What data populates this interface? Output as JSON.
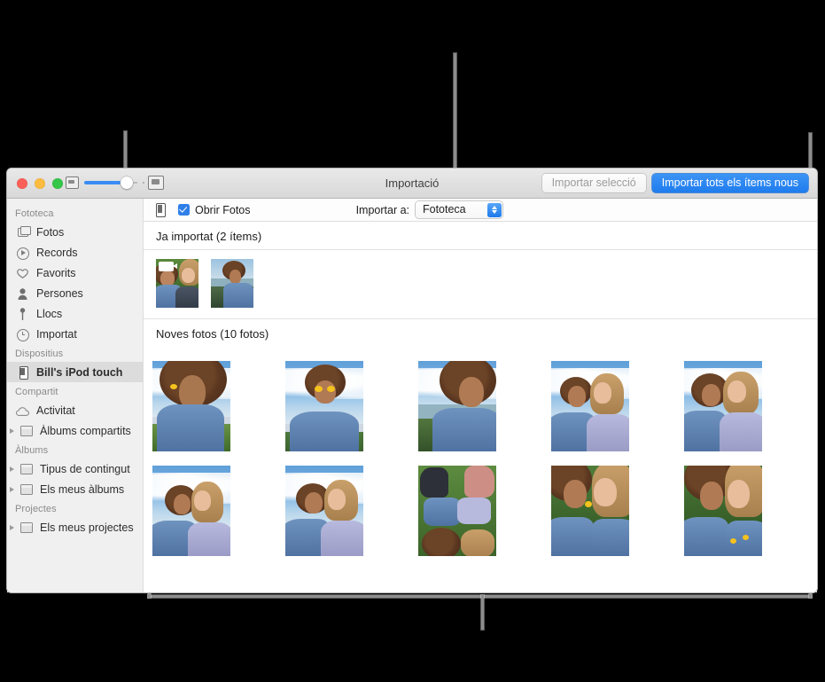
{
  "window": {
    "title": "Importació",
    "toolbar": {
      "zoom_small_icon": "small-thumbnail-icon",
      "zoom_large_icon": "large-thumbnail-icon",
      "zoom_value": 68,
      "buttons": [
        {
          "label": "Importar selecció",
          "style": "plain",
          "name": "import-selection-button"
        },
        {
          "label": "Importar tots els ítems nous",
          "style": "primary",
          "name": "import-all-new-button"
        }
      ]
    }
  },
  "sidebar": {
    "sections": [
      {
        "title": "Fototeca",
        "items": [
          {
            "label": "Fotos",
            "icon": "photos-icon",
            "selected": false,
            "disclosure": false
          },
          {
            "label": "Records",
            "icon": "memories-icon",
            "selected": false,
            "disclosure": false
          },
          {
            "label": "Favorits",
            "icon": "heart-icon",
            "selected": false,
            "disclosure": false
          },
          {
            "label": "Persones",
            "icon": "person-icon",
            "selected": false,
            "disclosure": false
          },
          {
            "label": "Llocs",
            "icon": "map-pin-icon",
            "selected": false,
            "disclosure": false
          },
          {
            "label": "Importat",
            "icon": "clock-icon",
            "selected": false,
            "disclosure": false
          }
        ]
      },
      {
        "title": "Dispositius",
        "items": [
          {
            "label": "Bill's iPod touch",
            "icon": "ipod-icon",
            "selected": true,
            "disclosure": false
          }
        ]
      },
      {
        "title": "Compartit",
        "items": [
          {
            "label": "Activitat",
            "icon": "cloud-icon",
            "selected": false,
            "disclosure": false
          },
          {
            "label": "Àlbums compartits",
            "icon": "folder-icon",
            "selected": false,
            "disclosure": true
          }
        ]
      },
      {
        "title": "Àlbums",
        "items": [
          {
            "label": "Tipus de contingut",
            "icon": "folder-icon",
            "selected": false,
            "disclosure": true
          },
          {
            "label": "Els meus àlbums",
            "icon": "folder-icon",
            "selected": false,
            "disclosure": true
          }
        ]
      },
      {
        "title": "Projectes",
        "items": [
          {
            "label": "Els meus projectes",
            "icon": "folder-icon",
            "selected": false,
            "disclosure": true
          }
        ]
      }
    ]
  },
  "import_bar": {
    "device_icon": "ipod-device-icon",
    "open_photos_label": "Obrir Fotos",
    "open_photos_checked": true,
    "import_to_label": "Importar a:",
    "import_to_value": "Fototeca",
    "import_to_options": [
      "Fototeca"
    ]
  },
  "content": {
    "already_imported": {
      "heading": "Ja importat (2 ítems)",
      "items": [
        {
          "name": "video-thumbnail-girls-on-grass",
          "is_video": true
        },
        {
          "name": "photo-thumbnail-girl-beach",
          "is_video": false
        }
      ]
    },
    "new_photos": {
      "heading": "Noves fotos (10 fotos)",
      "items": [
        {
          "name": "photo-girl-looking-up"
        },
        {
          "name": "photo-girl-flowers-eyes"
        },
        {
          "name": "photo-girl-smiling-sea"
        },
        {
          "name": "photo-two-girls-sunglasses"
        },
        {
          "name": "photo-two-girls-sky"
        },
        {
          "name": "photo-two-girls-sitting"
        },
        {
          "name": "photo-two-girls-peace-sign"
        },
        {
          "name": "photo-two-girls-lying-grass"
        },
        {
          "name": "photo-girls-laughing-grass"
        },
        {
          "name": "photo-girls-close-grass"
        }
      ]
    }
  },
  "annotations": {
    "callouts": [
      {
        "name": "callout-sidebar",
        "target": "sidebar-and-already-imported"
      },
      {
        "name": "callout-import-to",
        "target": "import-to-popup"
      },
      {
        "name": "callout-import-all",
        "target": "import-all-new-button"
      },
      {
        "name": "callout-new-photos",
        "target": "new-photos-grid"
      }
    ]
  },
  "colors": {
    "accent_blue": "#1f7ced",
    "checkbox_blue": "#2f7fe8",
    "selected_row": "#dcdcdc",
    "window_chrome": "#e3e3e3",
    "callout_grey": "#8d8d8d"
  }
}
